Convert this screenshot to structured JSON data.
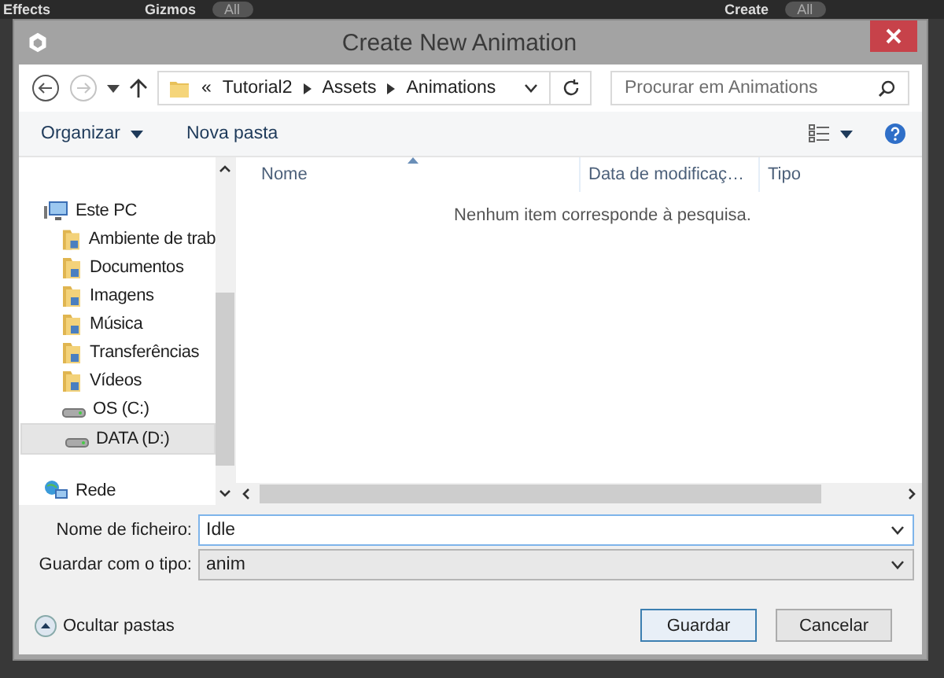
{
  "background_toolbar": {
    "items": [
      {
        "kind": "menu",
        "label": "Effects"
      },
      {
        "kind": "menu",
        "label": "Gizmos"
      },
      {
        "kind": "search",
        "placeholder": "All"
      },
      {
        "kind": "menu",
        "label": "Create"
      },
      {
        "kind": "search",
        "placeholder": "All"
      }
    ]
  },
  "window": {
    "title": "Create New Animation"
  },
  "navigation": {
    "back_enabled": true,
    "forward_enabled": false
  },
  "address_bar": {
    "prefix": "«",
    "breadcrumbs": [
      "Tutorial2",
      "Assets",
      "Animations"
    ]
  },
  "search": {
    "placeholder": "Procurar em Animations"
  },
  "command_bar": {
    "items": [
      {
        "label": "Organizar",
        "dropdown": true
      },
      {
        "label": "Nova pasta",
        "dropdown": false
      }
    ]
  },
  "sidebar": {
    "items": [
      {
        "label": "Este PC",
        "kind": "computer",
        "selected": false,
        "children": [
          {
            "label": "Ambiente de trab",
            "kind": "folder",
            "selected": false
          },
          {
            "label": "Documentos",
            "kind": "folder",
            "selected": false
          },
          {
            "label": "Imagens",
            "kind": "folder",
            "selected": false
          },
          {
            "label": "Música",
            "kind": "folder",
            "selected": false
          },
          {
            "label": "Transferências",
            "kind": "folder",
            "selected": false
          },
          {
            "label": "Vídeos",
            "kind": "folder",
            "selected": false
          },
          {
            "label": "OS (C:)",
            "kind": "drive",
            "selected": false
          },
          {
            "label": "DATA (D:)",
            "kind": "drive",
            "selected": true
          }
        ]
      },
      {
        "label": "Rede",
        "kind": "network",
        "selected": false
      }
    ]
  },
  "file_list": {
    "columns": [
      {
        "label": "Nome",
        "sorted": true
      },
      {
        "label": "Data de modificaç…",
        "sorted": false
      },
      {
        "label": "Tipo",
        "sorted": false
      }
    ],
    "empty_message": "Nenhum item corresponde à pesquisa."
  },
  "form": {
    "filename": {
      "label": "Nome de ficheiro:",
      "value": "Idle"
    },
    "file_type": {
      "label": "Guardar com o tipo:",
      "value": "anim"
    }
  },
  "hide_folders": {
    "label": "Ocultar pastas"
  },
  "buttons": [
    {
      "label": "Guardar",
      "default": true
    },
    {
      "label": "Cancelar",
      "default": false
    }
  ]
}
